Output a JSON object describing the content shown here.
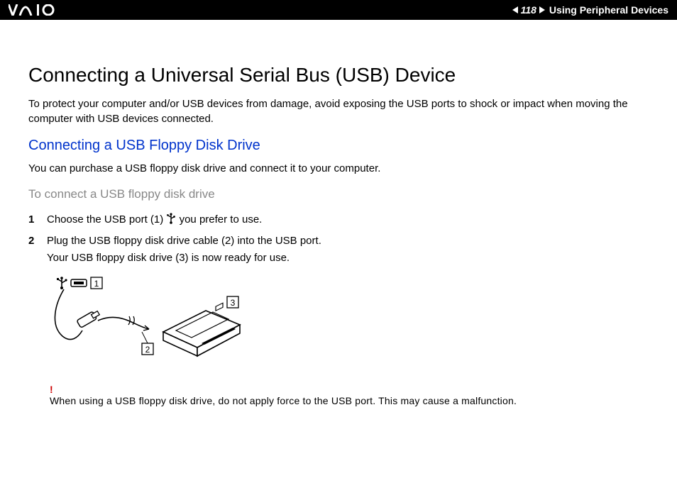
{
  "header": {
    "page_number": "118",
    "section": "Using Peripheral Devices"
  },
  "main": {
    "h1": "Connecting a Universal Serial Bus (USB) Device",
    "intro": "To protect your computer and/or USB devices from damage, avoid exposing the USB ports to shock or impact when moving the computer with USB devices connected.",
    "h2": "Connecting a USB Floppy Disk Drive",
    "h2_body": "You can purchase a USB floppy disk drive and connect it to your computer.",
    "subhead": "To connect a USB floppy disk drive",
    "steps": [
      {
        "n": "1",
        "before": "Choose the USB port (1) ",
        "after": " you prefer to use."
      },
      {
        "n": "2",
        "line1": "Plug the USB floppy disk drive cable (2) into the USB port.",
        "line2": "Your USB floppy disk drive (3) is now ready for use."
      }
    ],
    "labels": {
      "l1": "1",
      "l2": "2",
      "l3": "3"
    },
    "warning_mark": "!",
    "warning_text": "When using a USB floppy disk drive, do not apply force to the USB port. This may cause a malfunction."
  }
}
